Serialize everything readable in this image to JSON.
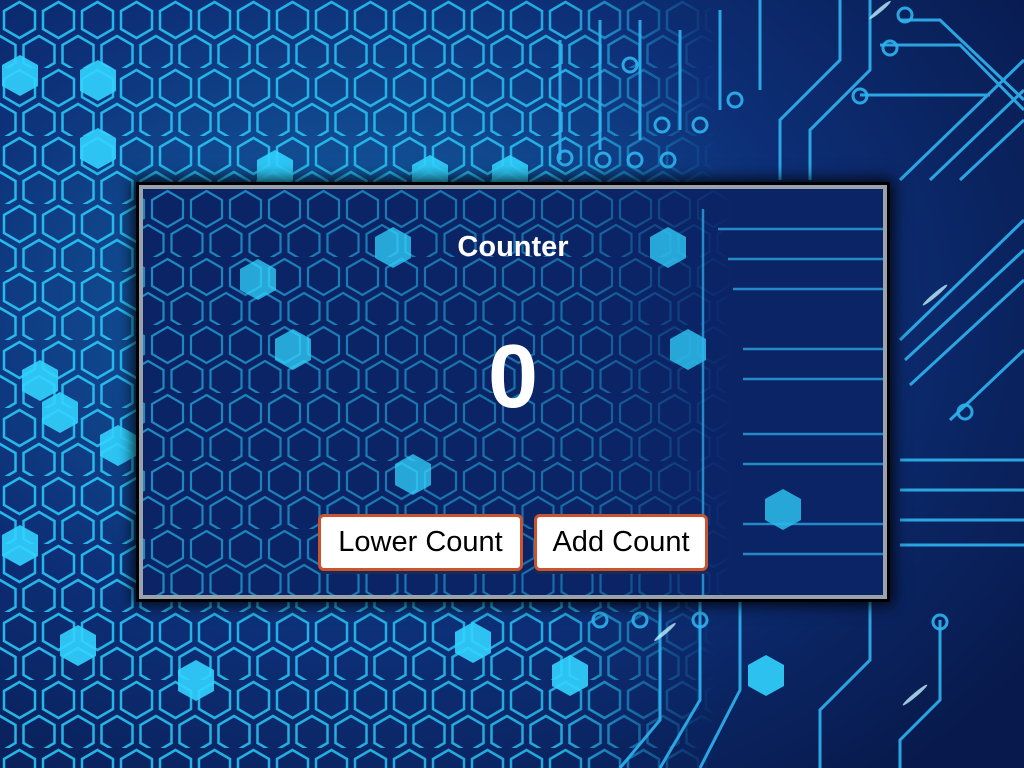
{
  "counter": {
    "title": "Counter",
    "value": "0",
    "lower_label": "Lower Count",
    "add_label": "Add Count"
  },
  "colors": {
    "background": "#0b1f5a",
    "circuit": "#27c4f5",
    "text": "#ffffff",
    "button_border": "#c9542f"
  }
}
